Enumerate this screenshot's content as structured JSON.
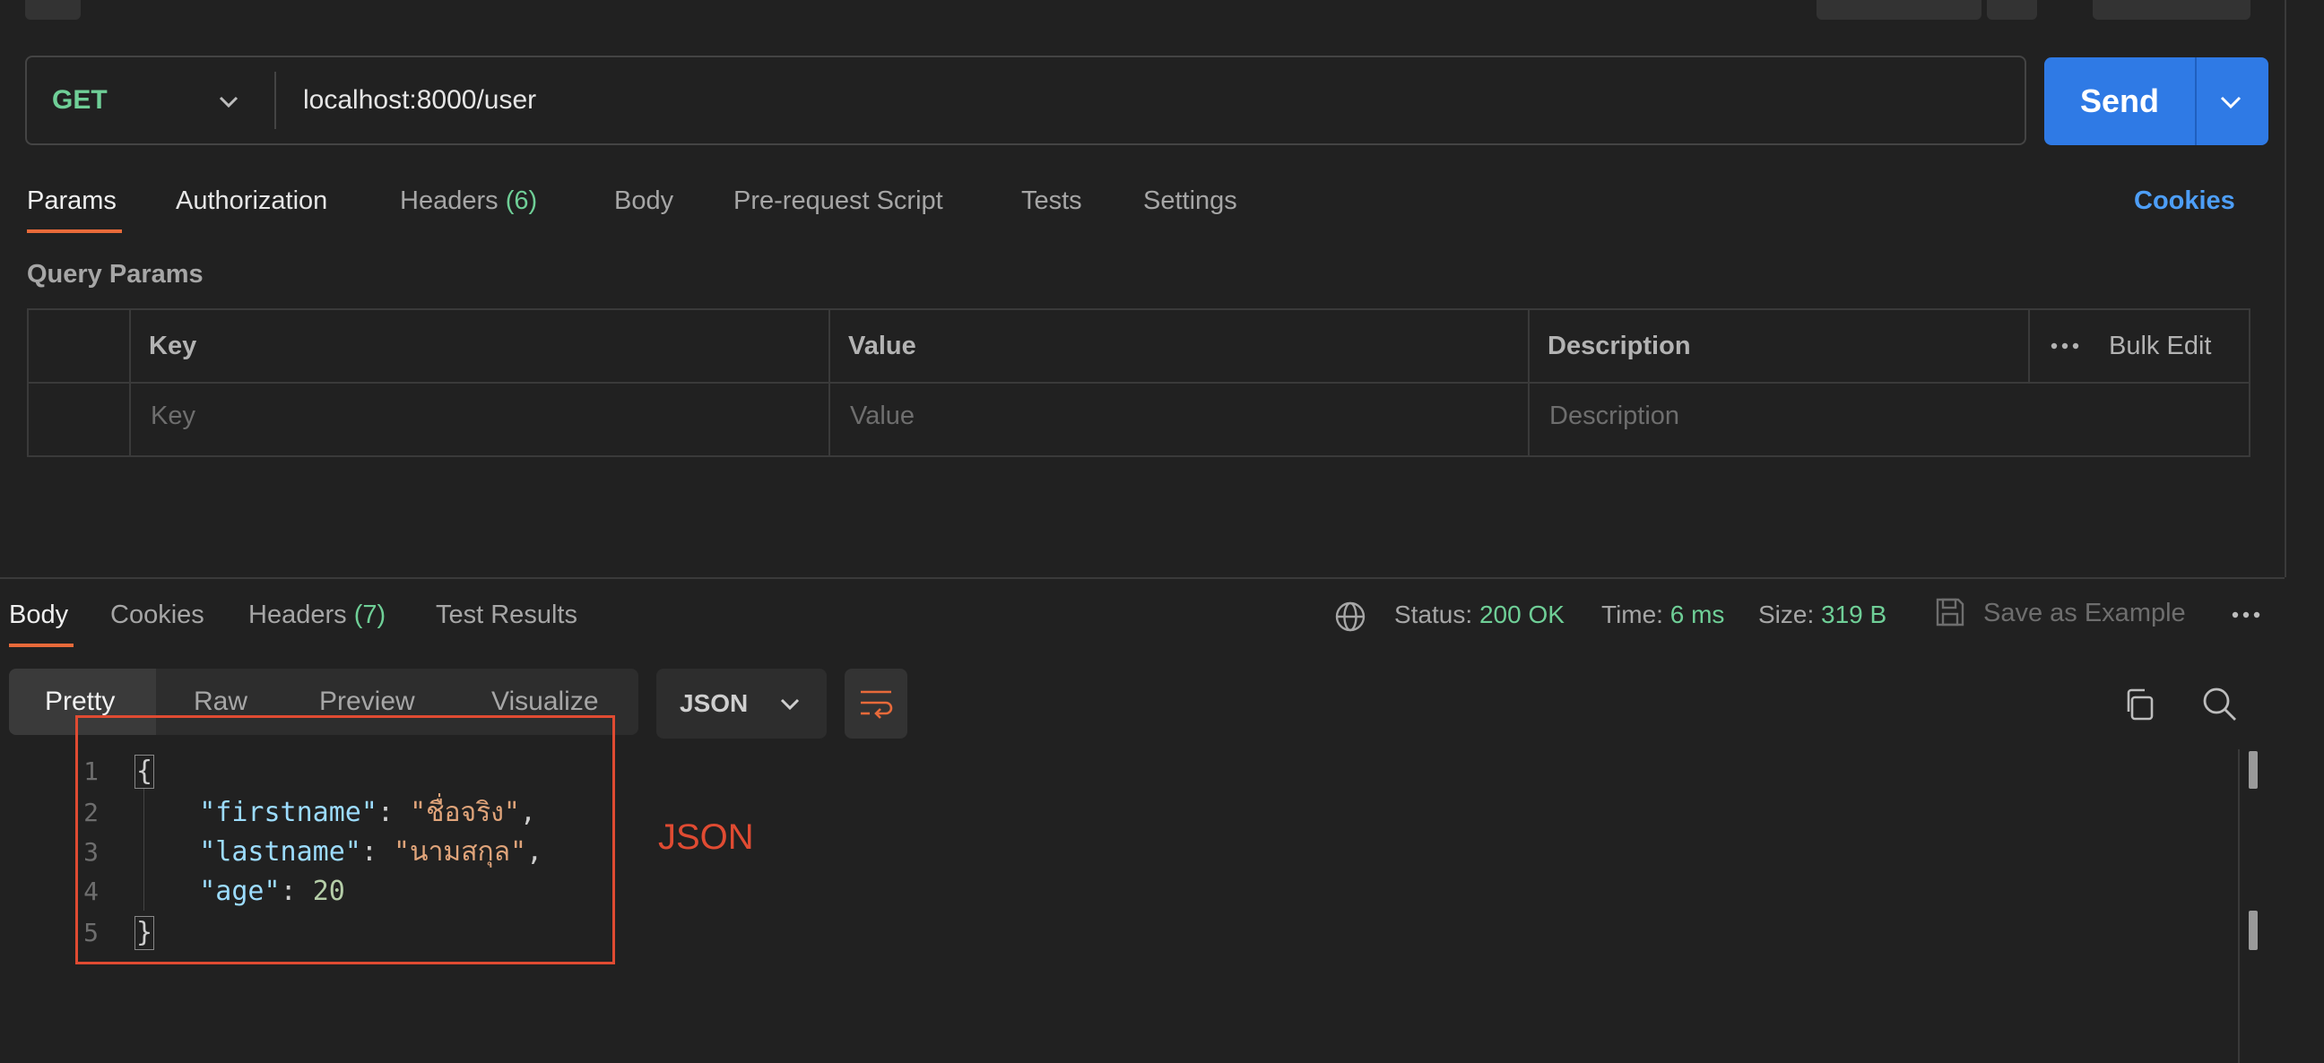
{
  "request": {
    "method": "GET",
    "url": "localhost:8000/user",
    "send_label": "Send"
  },
  "request_tabs": [
    {
      "label": "Params",
      "count": ""
    },
    {
      "label": "Authorization",
      "count": ""
    },
    {
      "label": "Headers",
      "count": "(6)"
    },
    {
      "label": "Body",
      "count": ""
    },
    {
      "label": "Pre-request Script",
      "count": ""
    },
    {
      "label": "Tests",
      "count": ""
    },
    {
      "label": "Settings",
      "count": ""
    }
  ],
  "cookies_link": "Cookies",
  "query_params": {
    "title": "Query Params",
    "headers": {
      "key": "Key",
      "value": "Value",
      "description": "Description"
    },
    "bulk_edit": "Bulk Edit",
    "placeholders": {
      "key": "Key",
      "value": "Value",
      "description": "Description"
    }
  },
  "response": {
    "tabs": [
      {
        "label": "Body",
        "count": ""
      },
      {
        "label": "Cookies",
        "count": ""
      },
      {
        "label": "Headers",
        "count": "(7)"
      },
      {
        "label": "Test Results",
        "count": ""
      }
    ],
    "status_label": "Status:",
    "status_value": "200 OK",
    "time_label": "Time:",
    "time_value": "6 ms",
    "size_label": "Size:",
    "size_value": "319 B",
    "save_example": "Save as Example",
    "views": [
      "Pretty",
      "Raw",
      "Preview",
      "Visualize"
    ],
    "format": "JSON",
    "lines": [
      "1",
      "2",
      "3",
      "4",
      "5"
    ],
    "body": {
      "open": "{",
      "close": "}",
      "k1": "\"firstname\"",
      "v1": "\"ชื่อจริง\"",
      "k2": "\"lastname\"",
      "v2": "\"นามสกุล\"",
      "k3": "\"age\"",
      "v3": "20"
    }
  },
  "annotation": "JSON",
  "colors": {
    "accent": "#e86a3a",
    "send": "#2f7ae5",
    "success": "#6fcf97",
    "link": "#4d9ef7",
    "annotation": "#e04b32"
  }
}
